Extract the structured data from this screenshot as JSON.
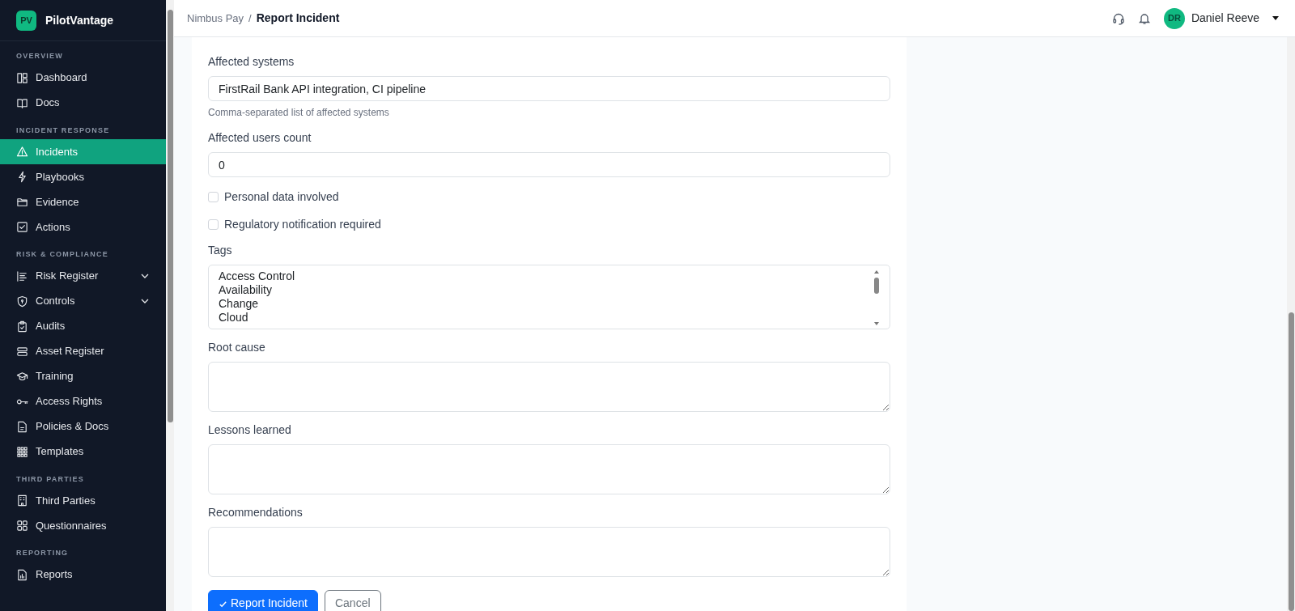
{
  "sidebar": {
    "brand": {
      "initials": "PV",
      "name": "PilotVantage"
    },
    "sections": [
      {
        "heading": "OVERVIEW",
        "items": [
          {
            "label": "Dashboard",
            "selected": false
          },
          {
            "label": "Docs",
            "selected": false
          }
        ]
      },
      {
        "heading": "INCIDENT RESPONSE",
        "items": [
          {
            "label": "Incidents",
            "selected": true
          },
          {
            "label": "Playbooks",
            "selected": false
          },
          {
            "label": "Evidence",
            "selected": false
          },
          {
            "label": "Actions",
            "selected": false
          }
        ]
      },
      {
        "heading": "RISK & COMPLIANCE",
        "items": [
          {
            "label": "Risk Register",
            "selected": false,
            "expanded": false
          },
          {
            "label": "Controls",
            "selected": false,
            "expanded": false
          },
          {
            "label": "Audits",
            "selected": false
          },
          {
            "label": "Asset Register",
            "selected": false
          },
          {
            "label": "Training",
            "selected": false
          },
          {
            "label": "Access Rights",
            "selected": false
          },
          {
            "label": "Policies & Docs",
            "selected": false
          },
          {
            "label": "Templates",
            "selected": false
          }
        ]
      },
      {
        "heading": "THIRD PARTIES",
        "items": [
          {
            "label": "Third Parties",
            "selected": false
          },
          {
            "label": "Questionnaires",
            "selected": false
          }
        ]
      },
      {
        "heading": "REPORTING",
        "items": [
          {
            "label": "Reports",
            "selected": false
          }
        ]
      }
    ]
  },
  "header": {
    "breadcrumb": {
      "parent": "Nimbus Pay",
      "separator": "/",
      "current": "Report Incident"
    },
    "user": {
      "initials": "DR",
      "name": "Daniel Reeve"
    }
  },
  "form": {
    "fields": [
      {
        "kind": "text",
        "label": "Affected systems",
        "value": "FirstRail Bank API integration, CI pipeline",
        "help": "Comma-separated list of affected systems"
      },
      {
        "kind": "text",
        "label": "Affected users count",
        "value": "0"
      },
      {
        "kind": "checkbox",
        "label": "Personal data involved",
        "checked": false
      },
      {
        "kind": "checkbox",
        "label": "Regulatory notification required",
        "checked": false
      },
      {
        "kind": "listbox",
        "label": "Tags",
        "options": [
          "Access Control",
          "Availability",
          "Change",
          "Cloud"
        ]
      },
      {
        "kind": "textarea",
        "label": "Root cause"
      },
      {
        "kind": "textarea",
        "label": "Lessons learned"
      },
      {
        "kind": "textarea",
        "label": "Recommendations"
      }
    ],
    "buttons": [
      {
        "kind": "primary",
        "label": "Report Incident"
      },
      {
        "kind": "secondary",
        "label": "Cancel"
      }
    ]
  }
}
